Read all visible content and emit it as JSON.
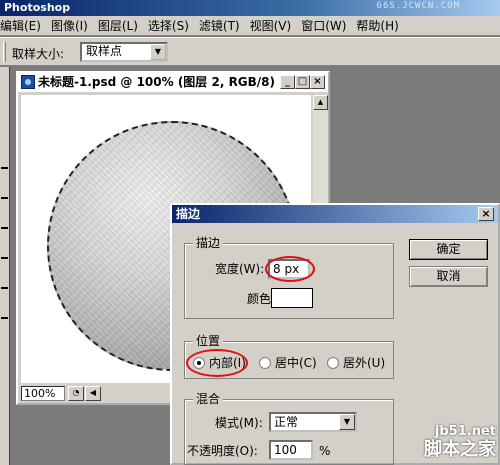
{
  "app": {
    "title": "Photoshop",
    "watermark": "66S.JCWCN.COM"
  },
  "menu": [
    "编辑(E)",
    "图像(I)",
    "图层(L)",
    "选择(S)",
    "滤镜(T)",
    "视图(V)",
    "窗口(W)",
    "帮助(H)"
  ],
  "options_bar": {
    "sample_size_label": "取样大小:",
    "sample_size_value": "取样点"
  },
  "document": {
    "title": "未标题-1.psd @ 100% (图层 2, RGB/8)",
    "zoom": "100%",
    "minimize": "_",
    "maximize": "□",
    "close": "×"
  },
  "dialog": {
    "title": "描边",
    "close": "×",
    "stroke_group": "描边",
    "width_label": "宽度(W):",
    "width_value": "8 px",
    "color_label": "颜色:",
    "location_group": "位置",
    "inside_label": "内部(I)",
    "center_label": "居中(C)",
    "outside_label": "居外(U)",
    "blend_group": "混合",
    "mode_label": "模式(M):",
    "mode_value": "正常",
    "opacity_label": "不透明度(O):",
    "opacity_value": "100",
    "opacity_unit": "%",
    "ok_label": "确定",
    "cancel_label": "取消"
  },
  "watermark": {
    "site": "jb51.net",
    "brand": "脚本之家"
  },
  "colors": {
    "highlight": "#e01010",
    "titlebar": "#0a246a"
  }
}
